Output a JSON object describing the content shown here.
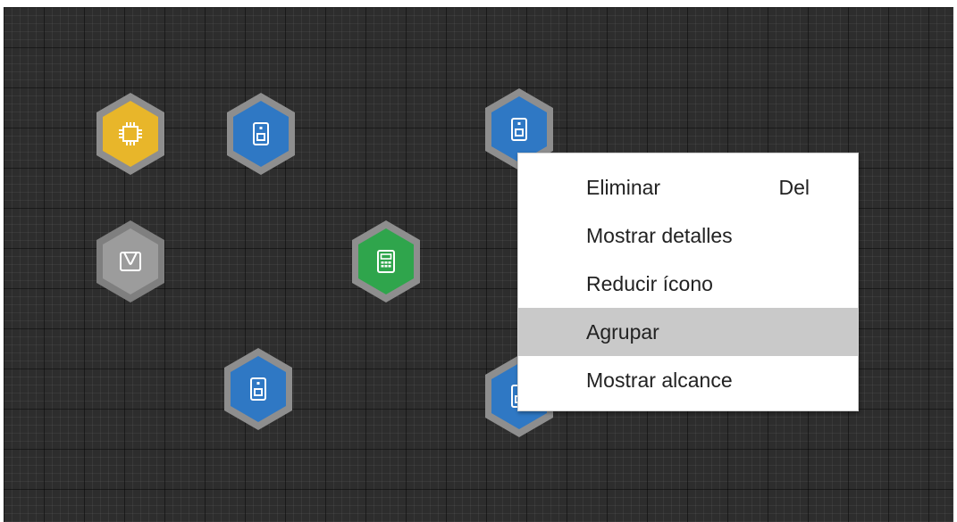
{
  "canvas": {
    "background": "#2d2d2d"
  },
  "nodes": [
    {
      "id": "node-chip",
      "color": "#e8b62a",
      "icon": "chip-icon"
    },
    {
      "id": "node-speaker-1",
      "color": "#2f78c4",
      "icon": "speaker-icon"
    },
    {
      "id": "node-speaker-2",
      "color": "#2f78c4",
      "icon": "speaker-icon"
    },
    {
      "id": "node-bag",
      "color": "#9a9a9a",
      "icon": "bag-icon"
    },
    {
      "id": "node-calculator",
      "color": "#2fa54c",
      "icon": "calculator-icon"
    },
    {
      "id": "node-speaker-3",
      "color": "#2f78c4",
      "icon": "speaker-icon"
    },
    {
      "id": "node-speaker-4",
      "color": "#2f78c4",
      "icon": "speaker-icon"
    }
  ],
  "context_menu": {
    "items": [
      {
        "label": "Eliminar",
        "shortcut": "Del"
      },
      {
        "label": "Mostrar detalles"
      },
      {
        "label": "Reducir ícono"
      },
      {
        "label": "Agrupar",
        "highlighted": true
      },
      {
        "label": "Mostrar alcance"
      }
    ]
  }
}
